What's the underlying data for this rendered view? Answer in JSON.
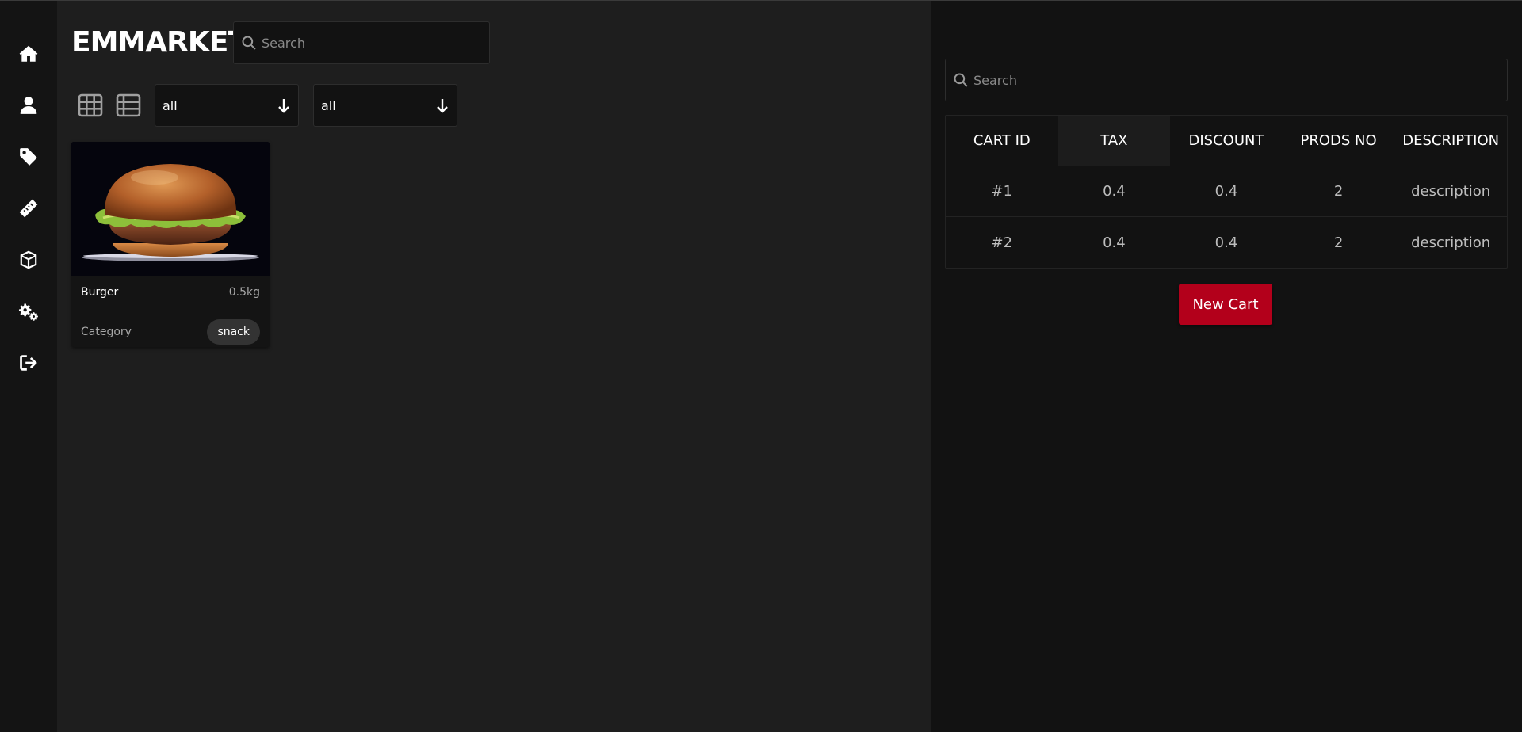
{
  "app": {
    "brand": "EMMARKET"
  },
  "sidebar": {
    "items": [
      {
        "name": "home",
        "icon": "home-icon"
      },
      {
        "name": "user",
        "icon": "user-icon"
      },
      {
        "name": "tags",
        "icon": "tag-icon"
      },
      {
        "name": "measure",
        "icon": "ruler-icon"
      },
      {
        "name": "products",
        "icon": "box-icon"
      },
      {
        "name": "settings",
        "icon": "gears-icon"
      },
      {
        "name": "logout",
        "icon": "logout-icon"
      }
    ]
  },
  "catalog": {
    "search": {
      "placeholder": "Search",
      "value": ""
    },
    "view_toggles": [
      {
        "icon": "grid-view-icon"
      },
      {
        "icon": "list-view-icon"
      }
    ],
    "filters": [
      {
        "selected": "all",
        "icon": "arrow-down-icon"
      },
      {
        "selected": "all",
        "icon": "arrow-down-icon"
      }
    ],
    "products": [
      {
        "name": "Burger",
        "weight": "0.5kg",
        "category_label": "Category",
        "category": "snack"
      }
    ]
  },
  "cart": {
    "search": {
      "placeholder": "Search",
      "value": ""
    },
    "columns": [
      "CART ID",
      "TAX",
      "DISCOUNT",
      "PRODS NO",
      "DESCRIPTION"
    ],
    "rows": [
      [
        "#1",
        "0.4",
        "0.4",
        "2",
        "description"
      ],
      [
        "#2",
        "0.4",
        "0.4",
        "2",
        "description"
      ]
    ],
    "new_cart_label": "New Cart"
  },
  "colors": {
    "sidebar_bg": "#141414",
    "main_bg": "#1e1e1e",
    "panel_bg": "#121212",
    "accent": "#b3001b",
    "chip_bg": "#333333"
  }
}
